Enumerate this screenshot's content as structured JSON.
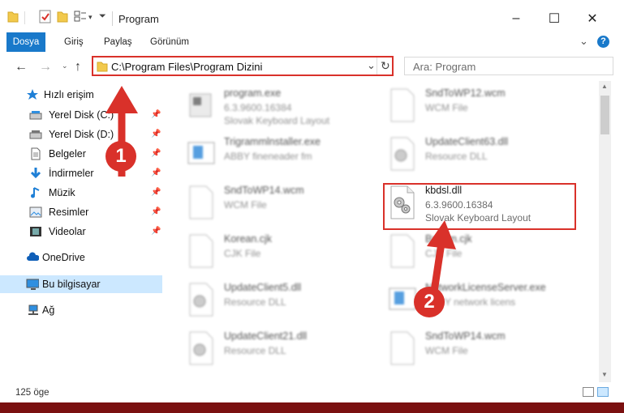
{
  "window": {
    "title": "Program",
    "controls": {
      "minimize": "–",
      "maximize": "☐",
      "close": "✕"
    }
  },
  "ribbon": {
    "tabs": [
      "Dosya",
      "Giriş",
      "Paylaş",
      "Görünüm"
    ],
    "expand_icon": "chevron-down-icon",
    "help_icon": "help-icon"
  },
  "address": {
    "path": "C:\\Program Files\\Program Dizini",
    "search_placeholder": "Ara: Program"
  },
  "sidebar": {
    "items": [
      {
        "label": "Hızlı erişim",
        "icon": "star-icon",
        "pinned": false
      },
      {
        "label": "Yerel Disk (C:)",
        "icon": "drive-icon",
        "pinned": true
      },
      {
        "label": "Yerel Disk (D:)",
        "icon": "drive-icon",
        "pinned": true
      },
      {
        "label": "Belgeler",
        "icon": "document-icon",
        "pinned": true
      },
      {
        "label": "İndirmeler",
        "icon": "download-icon",
        "pinned": true
      },
      {
        "label": "Müzik",
        "icon": "music-icon",
        "pinned": true
      },
      {
        "label": "Resimler",
        "icon": "picture-icon",
        "pinned": true
      },
      {
        "label": "Videolar",
        "icon": "video-icon",
        "pinned": true
      },
      {
        "label": "OneDrive",
        "icon": "cloud-icon",
        "pinned": false
      },
      {
        "label": "Bu bilgisayar",
        "icon": "computer-icon",
        "pinned": false,
        "selected": true
      },
      {
        "label": "Ağ",
        "icon": "network-icon",
        "pinned": false
      }
    ]
  },
  "files": [
    {
      "name": "program.exe",
      "line1": "6.3.9600.16384",
      "line2": "Slovak Keyboard Layout",
      "blurred": true
    },
    {
      "name": "SndToWP12.wcm",
      "line1": "WCM File",
      "line2": "",
      "blurred": true
    },
    {
      "name": "Trigrammlnstaller.exe",
      "line1": "ABBY fineneader fm",
      "line2": "",
      "blurred": true
    },
    {
      "name": "UpdateClient63.dll",
      "line1": "Resource DLL",
      "line2": "",
      "blurred": true
    },
    {
      "name": "SndToWP14.wcm",
      "line1": "WCM File",
      "line2": "",
      "blurred": true
    },
    {
      "name": "kbdsl.dll",
      "line1": "6.3.9600.16384",
      "line2": "Slovak Keyboard Layout",
      "blurred": false
    },
    {
      "name": "Korean.cjk",
      "line1": "CJK File",
      "line2": "",
      "blurred": true
    },
    {
      "name": "BrCom.cjk",
      "line1": "CJK File",
      "line2": "",
      "blurred": true
    },
    {
      "name": "UpdateClient5.dll",
      "line1": "Resource DLL",
      "line2": "",
      "blurred": true
    },
    {
      "name": "NetworkLicenseServer.exe",
      "line1": "ABBY network licens",
      "line2": "",
      "blurred": true
    },
    {
      "name": "UpdateClient21.dll",
      "line1": "Resource DLL",
      "line2": "",
      "blurred": true
    },
    {
      "name": "SndToWP14.wcm",
      "line1": "WCM File",
      "line2": "",
      "blurred": true
    }
  ],
  "status": {
    "item_count": "125 öge"
  },
  "annotations": {
    "marker1": "1",
    "marker2": "2",
    "color": "#d9312a"
  }
}
